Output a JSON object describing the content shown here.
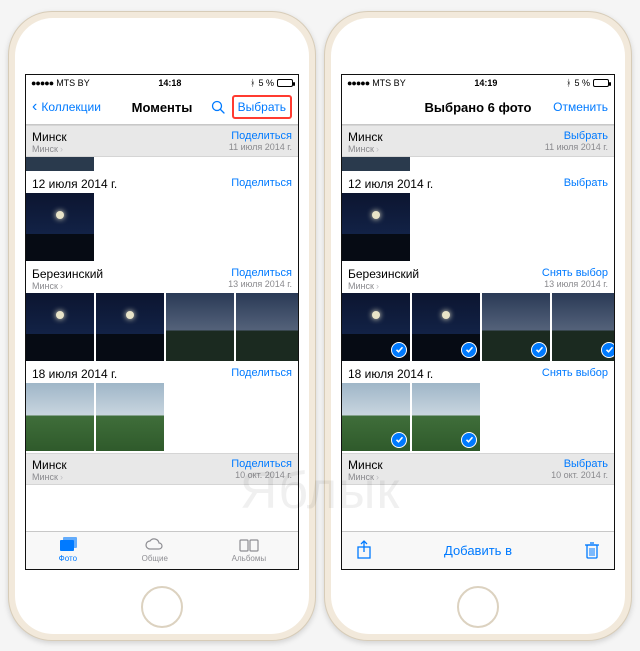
{
  "watermark": "Яблык",
  "left": {
    "status": {
      "carrier": "MTS BY",
      "time": "14:18",
      "battery": "5 %"
    },
    "nav": {
      "back": "Коллекции",
      "title": "Моменты",
      "select": "Выбрать"
    },
    "sections": [
      {
        "title": "Минск",
        "sub": "Минск",
        "action": "Поделиться",
        "date": "11 июля 2014 г."
      },
      {
        "title": "12 июля 2014 г.",
        "sub": "",
        "action": "Поделиться",
        "date": ""
      },
      {
        "title": "Березинский",
        "sub": "Минск",
        "action": "Поделиться",
        "date": "13 июля 2014 г."
      },
      {
        "title": "18 июля 2014 г.",
        "sub": "",
        "action": "Поделиться",
        "date": ""
      },
      {
        "title": "Минск",
        "sub": "Минск",
        "action": "Поделиться",
        "date": "10 окт. 2014 г."
      }
    ],
    "tabs": {
      "photos": "Фото",
      "shared": "Общие",
      "albums": "Альбомы"
    }
  },
  "right": {
    "status": {
      "carrier": "MTS BY",
      "time": "14:19",
      "battery": "5 %"
    },
    "nav": {
      "title": "Выбрано 6 фото",
      "cancel": "Отменить"
    },
    "sections": [
      {
        "title": "Минск",
        "sub": "Минск",
        "action": "Выбрать",
        "date": "11 июля 2014 г."
      },
      {
        "title": "12 июля 2014 г.",
        "sub": "",
        "action": "Выбрать",
        "date": ""
      },
      {
        "title": "Березинский",
        "sub": "Минск",
        "action": "Снять выбор",
        "date": "13 июля 2014 г."
      },
      {
        "title": "18 июля 2014 г.",
        "sub": "",
        "action": "Снять выбор",
        "date": ""
      },
      {
        "title": "Минск",
        "sub": "Минск",
        "action": "Выбрать",
        "date": "10 окт. 2014 г."
      }
    ],
    "toolbar": {
      "addto": "Добавить в"
    }
  }
}
